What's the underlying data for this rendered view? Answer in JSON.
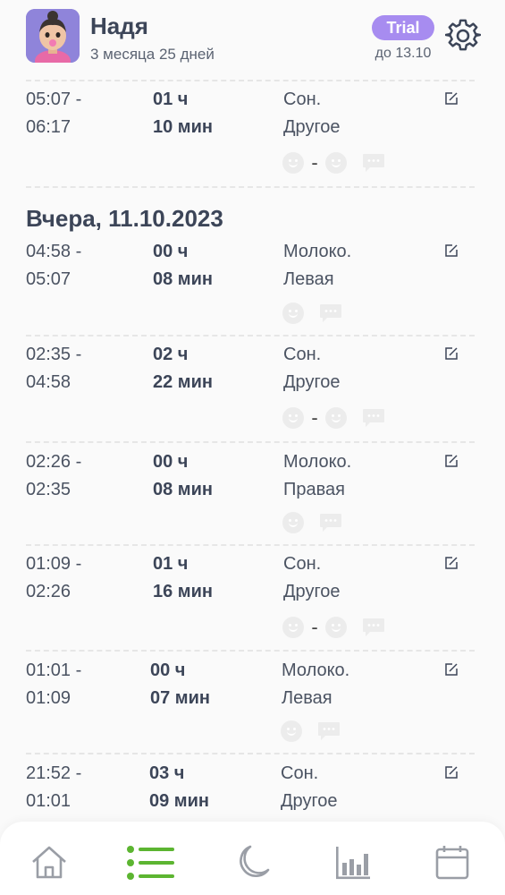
{
  "header": {
    "child_name": "Надя",
    "child_age": "3 месяца 25 дней",
    "trial_label": "Trial",
    "trial_until": "до 13.10",
    "avatar_icon": "child-avatar",
    "settings_icon": "gear-icon"
  },
  "sections": [
    {
      "title": "",
      "entries": [
        {
          "start": "05:07 -",
          "end": "06:17",
          "dur_h": "01 ч",
          "dur_m": "10 мин",
          "type": "Сон.",
          "sub": "Другое",
          "mood": "range"
        }
      ]
    },
    {
      "title": "Вчера, 11.10.2023",
      "entries": [
        {
          "start": "04:58 -",
          "end": "05:07",
          "dur_h": "00 ч",
          "dur_m": "08 мин",
          "type": "Молоко.",
          "sub": "Левая",
          "mood": "single"
        },
        {
          "start": "02:35 -",
          "end": "04:58",
          "dur_h": "02 ч",
          "dur_m": "22 мин",
          "type": "Сон.",
          "sub": "Другое",
          "mood": "range"
        },
        {
          "start": "02:26 -",
          "end": "02:35",
          "dur_h": "00 ч",
          "dur_m": "08 мин",
          "type": "Молоко.",
          "sub": "Правая",
          "mood": "single"
        },
        {
          "start": "01:09 -",
          "end": "02:26",
          "dur_h": "01 ч",
          "dur_m": "16 мин",
          "type": "Сон.",
          "sub": "Другое",
          "mood": "range"
        },
        {
          "start": "01:01 -",
          "end": "01:09",
          "dur_h": "00 ч",
          "dur_m": "07 мин",
          "type": "Молоко.",
          "sub": "Левая",
          "mood": "single"
        },
        {
          "start": "21:52 -",
          "end": "01:01",
          "dur_h": "03 ч",
          "dur_m": "09 мин",
          "type": "Сон.",
          "sub": "Другое",
          "mood": "none"
        }
      ]
    }
  ],
  "nav": {
    "items": [
      "home-icon",
      "list-icon",
      "moon-icon",
      "stats-icon",
      "calendar-icon"
    ],
    "active": "list-icon",
    "active_color": "#5cb531",
    "inactive_color": "#9a9ea6"
  }
}
